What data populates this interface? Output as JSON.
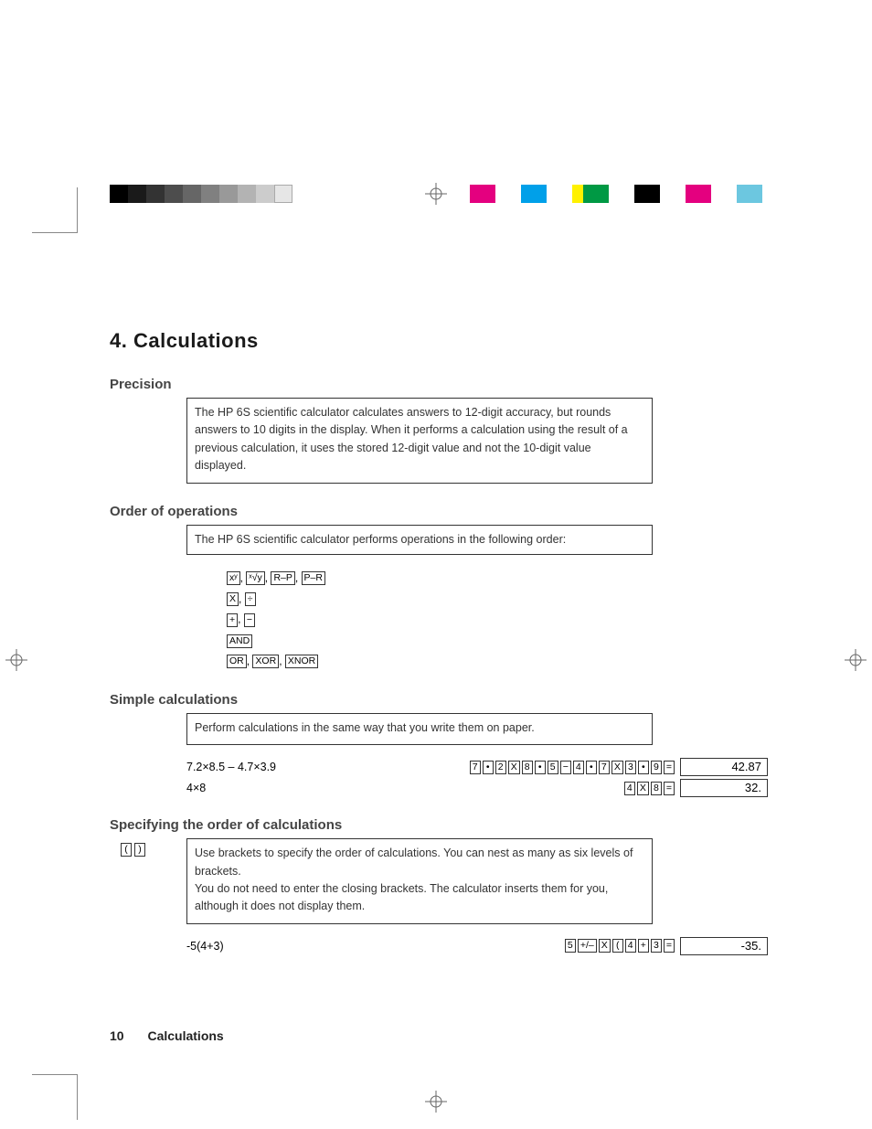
{
  "chapter_title": "4. Calculations",
  "sections": {
    "precision": {
      "heading": "Precision",
      "body": "The HP 6S scientific calculator calculates answers to 12-digit accuracy, but rounds answers to 10 digits in the display. When it performs a calculation using the result of a previous calculation,  it uses the stored 12-digit value and not the 10-digit value displayed."
    },
    "order": {
      "heading": "Order of operations",
      "body": "The HP 6S scientific calculator performs operations in the following order:",
      "rows": [
        [
          "xʸ",
          "ˣ√y",
          "R–P",
          "P–R"
        ],
        [
          "X",
          "÷"
        ],
        [
          "+",
          "−"
        ],
        [
          "AND"
        ],
        [
          "OR",
          "XOR",
          "XNOR"
        ]
      ]
    },
    "simple": {
      "heading": "Simple calculations",
      "body": "Perform calculations in the same way that you write them on paper.",
      "examples": [
        {
          "expr": "7.2×8.5 – 4.7×3.9",
          "keys": [
            "7",
            "•",
            "2",
            "X",
            "8",
            "•",
            "5",
            "−",
            "4",
            "•",
            "7",
            "X",
            "3",
            "•",
            "9",
            "="
          ],
          "result": "42.87"
        },
        {
          "expr": "4×8",
          "keys": [
            "4",
            "X",
            "8",
            "="
          ],
          "result": "32."
        }
      ]
    },
    "specify": {
      "heading": "Specifying the order of calculations",
      "side_keys": [
        "(",
        ")"
      ],
      "body": "Use brackets to specify the order of calculations. You can nest as many as six levels of brackets.\nYou do not need to enter the closing brackets. The calculator inserts them for you, although it does not display them.",
      "examples": [
        {
          "expr": "-5(4+3)",
          "keys": [
            "5",
            "+/–",
            "X",
            "(",
            "4",
            "+",
            "3",
            "="
          ],
          "result": "-35."
        }
      ]
    }
  },
  "footer": {
    "page_number": "10",
    "chapter": "Calculations"
  }
}
